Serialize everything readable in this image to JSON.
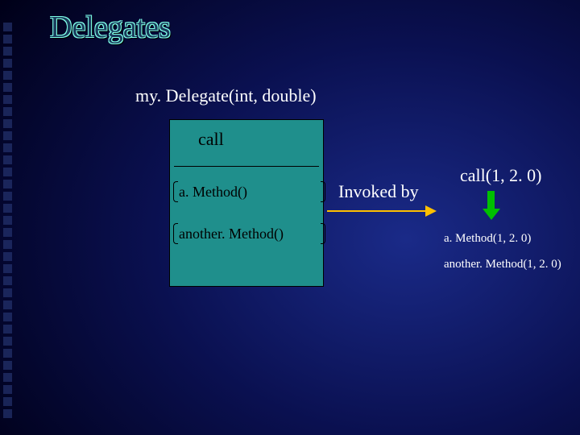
{
  "title": "Delegates",
  "delegate_signature": "my. Delegate(int, double)",
  "box": {
    "call_label": "call",
    "methods": [
      "a. Method()",
      "another. Method()"
    ]
  },
  "invoked_label": "Invoked by",
  "invocation": {
    "call": "call(1, 2. 0)",
    "results": [
      "a. Method(1, 2. 0)",
      "another. Method(1, 2. 0)"
    ]
  }
}
